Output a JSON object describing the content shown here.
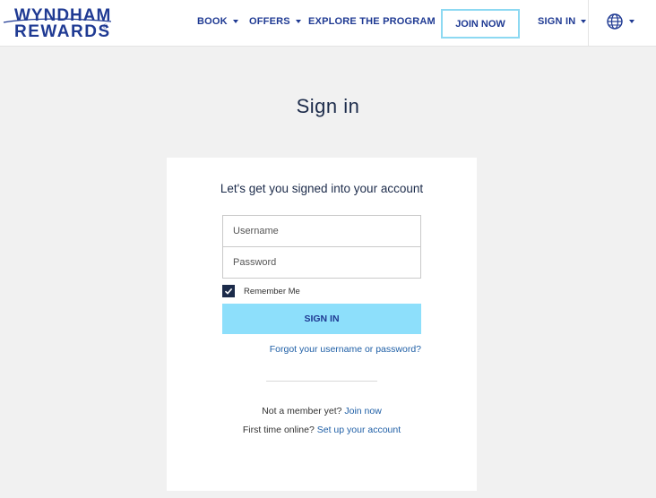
{
  "brand": {
    "logo_line1": "WYNDHAM",
    "logo_line2": "REWARDS",
    "logo_reg": "®",
    "color_primary": "#1f3a93",
    "color_accent": "#8ddffb"
  },
  "nav": {
    "items": [
      {
        "label": "BOOK",
        "icon": "chevron-down-icon"
      },
      {
        "label": "OFFERS",
        "icon": "chevron-down-icon"
      },
      {
        "label": "EXPLORE THE PROGRAM",
        "icon": "chevron-down-icon"
      }
    ],
    "join_label": "JOIN NOW",
    "signin_label": "SIGN IN",
    "language_icon": "globe-icon"
  },
  "page": {
    "title": "Sign in"
  },
  "form": {
    "heading": "Let's get you signed into your account",
    "username_placeholder": "Username",
    "password_placeholder": "Password",
    "username_value": "",
    "password_value": "",
    "remember_label": "Remember Me",
    "remember_checked": true,
    "submit_label": "SIGN IN",
    "forgot_link": "Forgot your username or password?"
  },
  "footer_links": {
    "member_prefix": "Not a member yet? ",
    "member_link": "Join now",
    "first_prefix": "First time online? ",
    "first_link": "Set up your account"
  }
}
